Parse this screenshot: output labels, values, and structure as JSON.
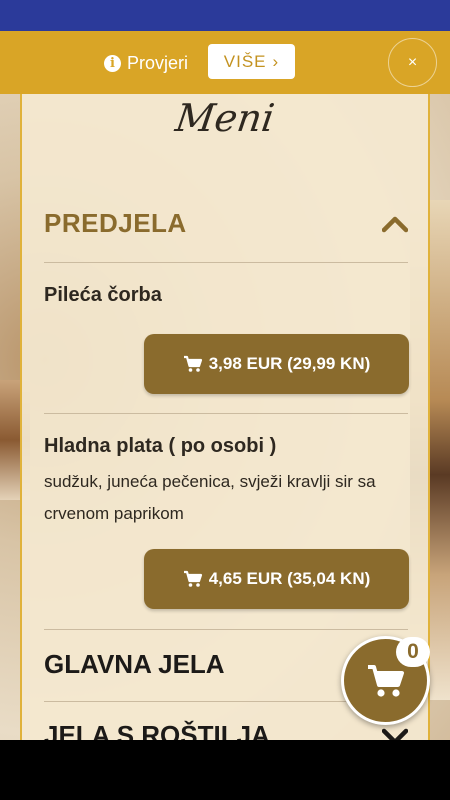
{
  "notice": {
    "info_icon_glyph": "i",
    "text": "Provjeri",
    "more_label": "VIŠE",
    "more_chevron": "›",
    "close_glyph": "×"
  },
  "menu_title": "Meni",
  "sections": {
    "predjela": {
      "title": "PREDJELA",
      "icon": "chevron-up-icon"
    },
    "glavna_jela": {
      "title": "GLAVNA JELA"
    },
    "jela_s_rostilja": {
      "title": "JELA S ROŠTILJA",
      "icon": "chevron-down-icon"
    }
  },
  "items": [
    {
      "name": "Pileća čorba",
      "description": "",
      "price": "3,98 EUR (29,99 KN)"
    },
    {
      "name": "Hladna plata ( po osobi )",
      "description": "sudžuk, juneća pečenica, svježi kravlji sir sa crvenom paprikom",
      "price": "4,65 EUR (35,04 KN)"
    }
  ],
  "cart": {
    "count": "0",
    "icon": "shopping-cart-icon"
  },
  "colors": {
    "accent_gold": "#d9a526",
    "brown": "#8a6b2d",
    "status_bar": "#2b3a9a"
  }
}
